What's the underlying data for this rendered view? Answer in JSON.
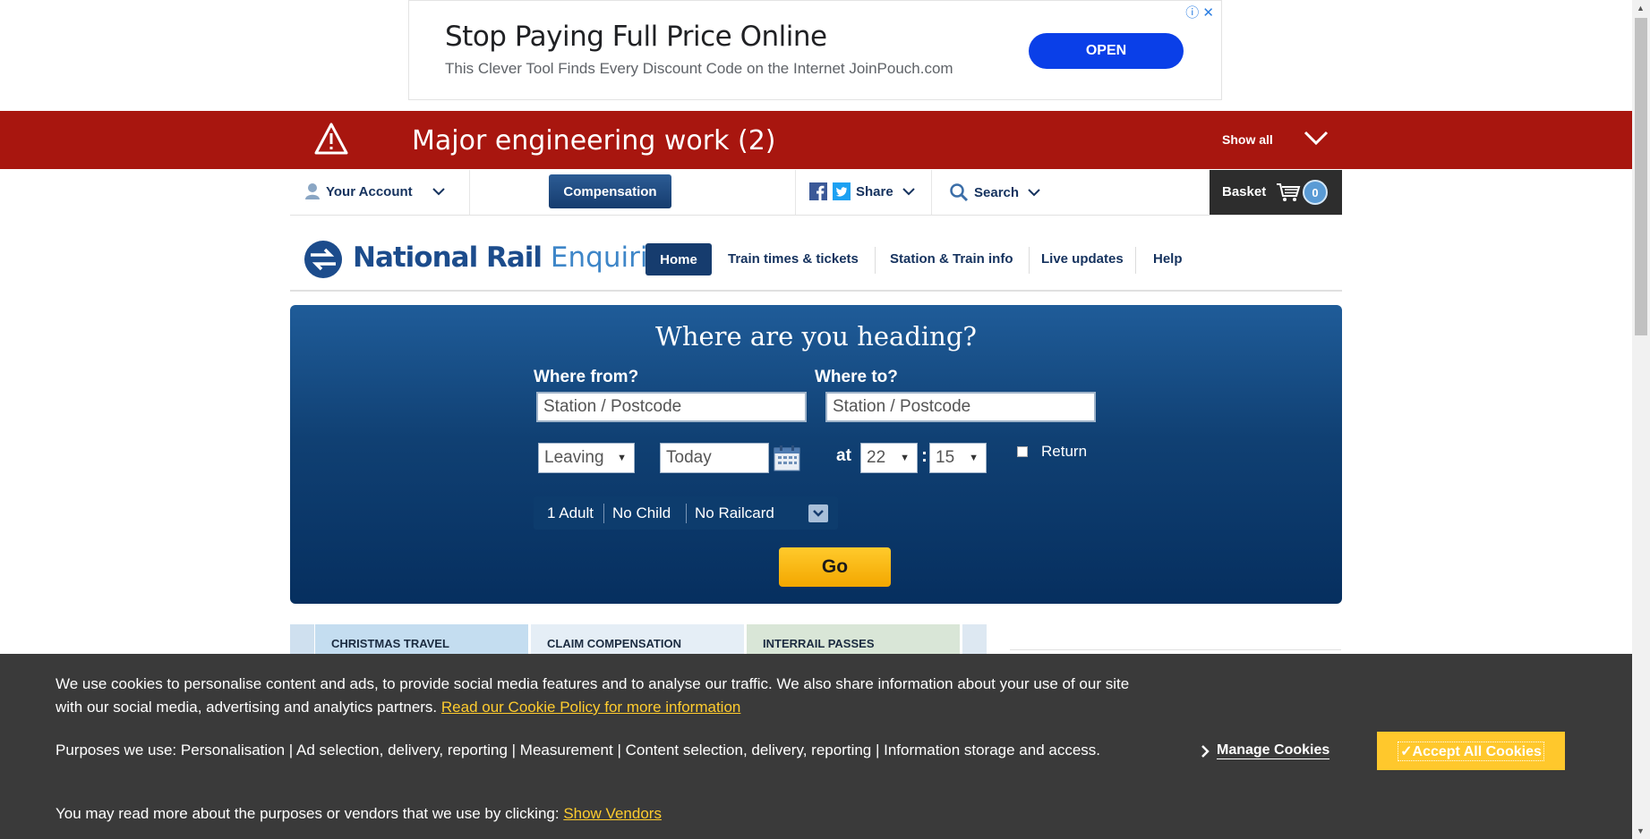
{
  "ad": {
    "headline": "Stop Paying Full Price Online",
    "subtext": "This Clever Tool Finds Every Discount Code on the Internet JoinPouch.com",
    "cta": "OPEN",
    "adchoices": "ⓘ ✕"
  },
  "alert": {
    "icon": "warning-triangle-icon",
    "title": "Major engineering work (2)",
    "show_all": "Show all"
  },
  "utility": {
    "account": "Your Account",
    "compensation": "Compensation",
    "share": "Share",
    "search": "Search",
    "basket": "Basket",
    "basket_count": "0"
  },
  "nav": {
    "logo_bold": "National Rail",
    "logo_light": "Enquiries",
    "items": [
      "Home",
      "Train times & tickets",
      "Station & Train info",
      "Live updates",
      "Help"
    ]
  },
  "search_panel": {
    "heading": "Where are you heading?",
    "from_label": "Where from?",
    "from_placeholder": "Station / Postcode",
    "to_label": "Where to?",
    "to_placeholder": "Station / Postcode",
    "leaving": "Leaving",
    "date": "Today",
    "at": "at",
    "hour": "22",
    "minute": "15",
    "return_label": "Return",
    "passengers": [
      "1 Adult",
      "No Child",
      "No Railcard"
    ],
    "go": "Go"
  },
  "tiles": [
    "CHRISTMAS TRAVEL",
    "CLAIM COMPENSATION",
    "INTERRAIL PASSES"
  ],
  "cookie": {
    "p1": "We use cookies to personalise content and ads, to provide social media features and to analyse our traffic. We also share information about your use of our site with our social media, advertising and analytics partners.",
    "p1_link": "Read our Cookie Policy for more information",
    "p2": "Purposes we use: Personalisation | Ad selection, delivery, reporting | Measurement | Content selection, delivery, reporting | Information storage and access.",
    "p3": "You may read more about the purposes or vendors that we use by clicking:",
    "p3_link": "Show Vendors",
    "manage": "Manage Cookies",
    "accept": "✓Accept All Cookies"
  },
  "colors": {
    "alert_red": "#a8160f",
    "brand_navy": "#163c6e",
    "go_yellow": "#f3a700",
    "cookie_bg": "#3a3a3a"
  }
}
